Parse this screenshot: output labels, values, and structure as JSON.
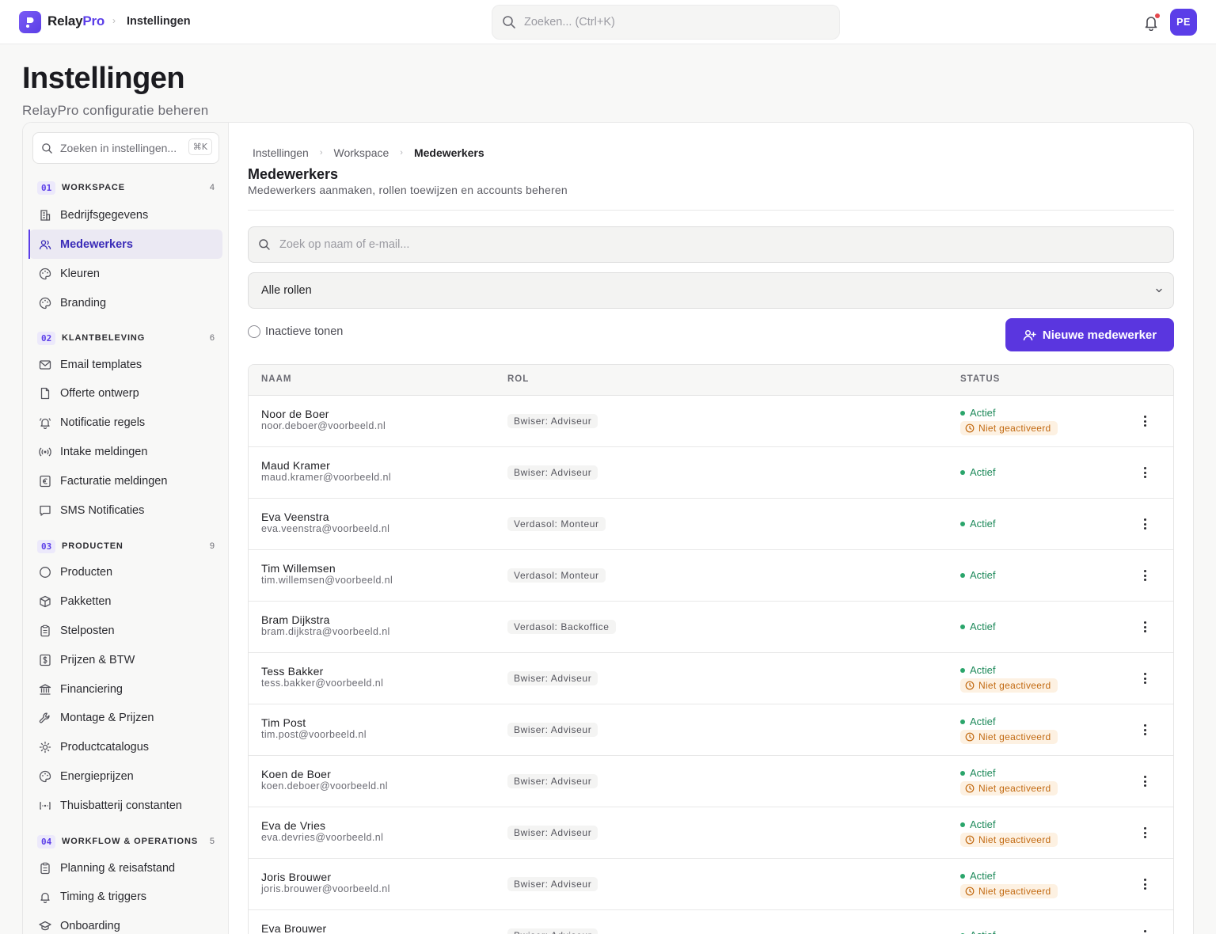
{
  "app": {
    "brand_relay": "Relay",
    "brand_pro": "Pro",
    "breadcrumb_top": "Instellingen",
    "search_placeholder": "Zoeken... (Ctrl+K)",
    "avatar_initials": "PE",
    "accent": "#5b3ee8"
  },
  "page": {
    "title": "Instellingen",
    "subtitle": "RelayPro configuratie beheren"
  },
  "sidebar": {
    "search_placeholder": "Zoeken in instellingen...",
    "search_shortcut": "⌘K",
    "sections": [
      {
        "num": "01",
        "label": "WORKSPACE",
        "count": "4"
      },
      {
        "num": "02",
        "label": "KLANTBELEVING",
        "count": "6"
      },
      {
        "num": "03",
        "label": "PRODUCTEN",
        "count": "9"
      },
      {
        "num": "04",
        "label": "WORKFLOW & OPERATIONS",
        "count": "5"
      }
    ],
    "items": [
      {
        "label": "Bedrijfsgegevens",
        "icon": "building-icon"
      },
      {
        "label": "Medewerkers",
        "icon": "users-icon",
        "active": true
      },
      {
        "label": "Kleuren",
        "icon": "palette-icon"
      },
      {
        "label": "Branding",
        "icon": "palette-icon"
      },
      {
        "label": "Email templates",
        "icon": "mail-icon"
      },
      {
        "label": "Offerte ontwerp",
        "icon": "file-icon"
      },
      {
        "label": "Notificatie regels",
        "icon": "bell-ring-icon"
      },
      {
        "label": "Intake meldingen",
        "icon": "broadcast-icon"
      },
      {
        "label": "Facturatie meldingen",
        "icon": "euro-icon"
      },
      {
        "label": "SMS Notificaties",
        "icon": "message-icon"
      },
      {
        "label": "Producten",
        "icon": "circle-icon"
      },
      {
        "label": "Pakketten",
        "icon": "package-icon"
      },
      {
        "label": "Stelposten",
        "icon": "clipboard-icon"
      },
      {
        "label": "Prijzen & BTW",
        "icon": "dollar-icon"
      },
      {
        "label": "Financiering",
        "icon": "bank-icon"
      },
      {
        "label": "Montage & Prijzen",
        "icon": "wrench-icon"
      },
      {
        "label": "Productcatalogus",
        "icon": "sun-icon"
      },
      {
        "label": "Energieprijzen",
        "icon": "palette-icon"
      },
      {
        "label": "Thuisbatterij constanten",
        "icon": "battery-icon"
      },
      {
        "label": "Planning & reisafstand",
        "icon": "clipboard-icon"
      },
      {
        "label": "Timing & triggers",
        "icon": "bell-icon"
      },
      {
        "label": "Onboarding",
        "icon": "graduation-icon"
      }
    ]
  },
  "content": {
    "breadcrumb": [
      "Instellingen",
      "Workspace",
      "Medewerkers"
    ],
    "title": "Medewerkers",
    "subtitle": "Medewerkers aanmaken, rollen toewijzen en accounts beheren",
    "search_placeholder": "Zoek op naam of e-mail...",
    "role_filter": "Alle rollen",
    "toggle_label": "Inactieve tonen",
    "new_button": "Nieuwe medewerker",
    "columns": [
      "NAAM",
      "ROL",
      "STATUS"
    ],
    "rows": [
      {
        "name": "Noor de Boer",
        "email": "noor.deboer@voorbeeld.nl",
        "role": "Bwiser: Adviseur",
        "status": "Actief",
        "inactive": "Niet geactiveerd"
      },
      {
        "name": "Maud Kramer",
        "email": "maud.kramer@voorbeeld.nl",
        "role": "Bwiser: Adviseur",
        "status": "Actief",
        "inactive": null
      },
      {
        "name": "Eva Veenstra",
        "email": "eva.veenstra@voorbeeld.nl",
        "role": "Verdasol: Monteur",
        "status": "Actief",
        "inactive": null
      },
      {
        "name": "Tim Willemsen",
        "email": "tim.willemsen@voorbeeld.nl",
        "role": "Verdasol: Monteur",
        "status": "Actief",
        "inactive": null
      },
      {
        "name": "Bram Dijkstra",
        "email": "bram.dijkstra@voorbeeld.nl",
        "role": "Verdasol: Backoffice",
        "status": "Actief",
        "inactive": null
      },
      {
        "name": "Tess Bakker",
        "email": "tess.bakker@voorbeeld.nl",
        "role": "Bwiser: Adviseur",
        "status": "Actief",
        "inactive": "Niet geactiveerd"
      },
      {
        "name": "Tim Post",
        "email": "tim.post@voorbeeld.nl",
        "role": "Bwiser: Adviseur",
        "status": "Actief",
        "inactive": "Niet geactiveerd"
      },
      {
        "name": "Koen de Boer",
        "email": "koen.deboer@voorbeeld.nl",
        "role": "Bwiser: Adviseur",
        "status": "Actief",
        "inactive": "Niet geactiveerd"
      },
      {
        "name": "Eva de Vries",
        "email": "eva.devries@voorbeeld.nl",
        "role": "Bwiser: Adviseur",
        "status": "Actief",
        "inactive": "Niet geactiveerd"
      },
      {
        "name": "Joris Brouwer",
        "email": "joris.brouwer@voorbeeld.nl",
        "role": "Bwiser: Adviseur",
        "status": "Actief",
        "inactive": "Niet geactiveerd"
      },
      {
        "name": "Eva Brouwer",
        "email": "",
        "role": "Bwiser: Adviseur",
        "status": "Actief",
        "inactive": null
      }
    ]
  }
}
